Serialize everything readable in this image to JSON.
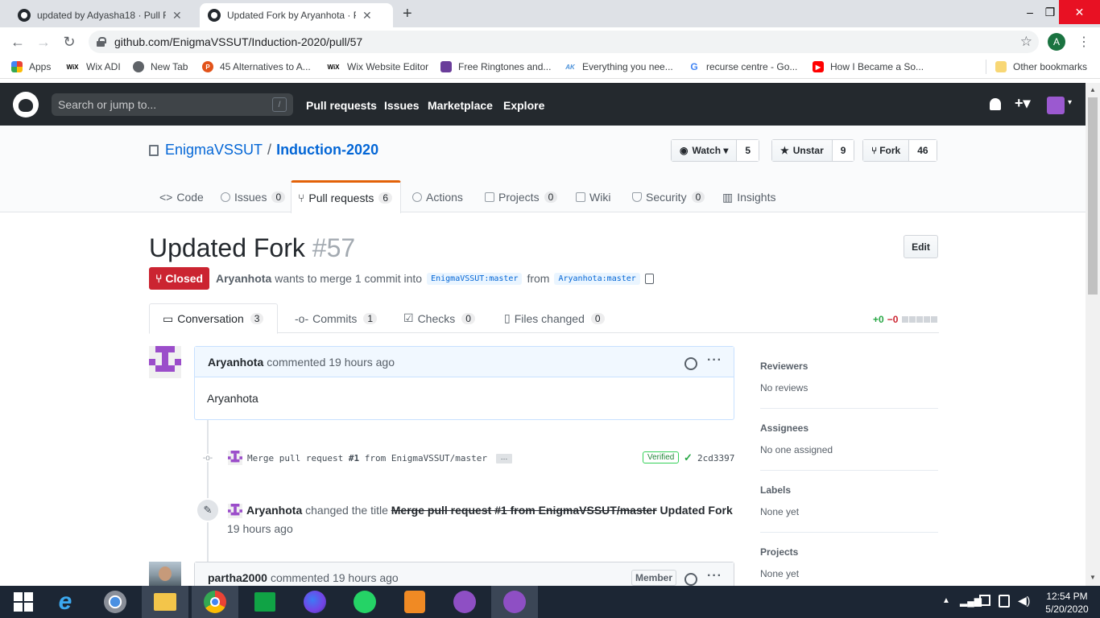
{
  "browser": {
    "tabs": [
      {
        "title": "updated by Adyasha18 · Pull Requ",
        "active": false
      },
      {
        "title": "Updated Fork by Aryanhota · Pull",
        "active": true
      }
    ],
    "new_tab": "+",
    "window_controls": {
      "minimize": "–",
      "maximize": "❐",
      "close": "✕"
    },
    "url": "github.com/EnigmaVSSUT/Induction-2020/pull/57",
    "profile_initial": "A",
    "bookmarks": [
      {
        "label": "Apps",
        "icon": "apps-grid-icon"
      },
      {
        "label": "Wix ADI",
        "icon": "wix-icon"
      },
      {
        "label": "New Tab",
        "icon": "globe-icon"
      },
      {
        "label": "45 Alternatives to A...",
        "icon": "p-badge-icon"
      },
      {
        "label": "Wix Website Editor",
        "icon": "wix-icon"
      },
      {
        "label": "Free Ringtones and...",
        "icon": "ringtone-icon"
      },
      {
        "label": "Everything you nee...",
        "icon": "ak-icon"
      },
      {
        "label": "recurse centre - Go...",
        "icon": "google-icon"
      },
      {
        "label": "How I Became a So...",
        "icon": "youtube-icon"
      }
    ],
    "other_bookmarks": "Other bookmarks"
  },
  "github_header": {
    "search_placeholder": "Search or jump to...",
    "search_key": "/",
    "nav": [
      "Pull requests",
      "Issues",
      "Marketplace",
      "Explore"
    ],
    "plus": "+▾"
  },
  "repo": {
    "owner": "EnigmaVSSUT",
    "separator": "/",
    "name": "Induction-2020",
    "watch": {
      "label": "Watch ▾",
      "count": "5"
    },
    "star": {
      "label": "Unstar",
      "count": "9"
    },
    "fork": {
      "label": "Fork",
      "count": "46"
    },
    "tabs": [
      {
        "label": "Code",
        "count": null
      },
      {
        "label": "Issues",
        "count": "0"
      },
      {
        "label": "Pull requests",
        "count": "6"
      },
      {
        "label": "Actions",
        "count": null
      },
      {
        "label": "Projects",
        "count": "0"
      },
      {
        "label": "Wiki",
        "count": null
      },
      {
        "label": "Security",
        "count": "0"
      },
      {
        "label": "Insights",
        "count": null
      }
    ]
  },
  "pr": {
    "title": "Updated Fork",
    "number": "#57",
    "edit": "Edit",
    "state": "Closed",
    "author": "Aryanhota",
    "merge_text": "wants to merge 1 commit into",
    "base_branch": "EnigmaVSSUT:master",
    "from": "from",
    "head_branch": "Aryanhota:master",
    "tabs": [
      {
        "label": "Conversation",
        "count": "3"
      },
      {
        "label": "Commits",
        "count": "1"
      },
      {
        "label": "Checks",
        "count": "0"
      },
      {
        "label": "Files changed",
        "count": "0"
      }
    ],
    "diff": {
      "add": "+0",
      "del": "−0"
    }
  },
  "timeline": {
    "comment1": {
      "author": "Aryanhota",
      "action": "commented 19 hours ago",
      "body": "Aryanhota"
    },
    "commit": {
      "message_pre": "Merge pull request ",
      "message_ref": "#1",
      "message_post": " from EnigmaVSSUT/master",
      "ellipsis": "…",
      "verified": "Verified",
      "check": "✓",
      "sha": "2cd3397"
    },
    "rename": {
      "author": "Aryanhota",
      "action": "changed the title",
      "old_title": "Merge pull request #1 from EnigmaVSSUT/master",
      "new_title": "Updated Fork",
      "time": "19 hours ago"
    },
    "comment2": {
      "author": "partha2000",
      "action": "commented 19 hours ago",
      "badge": "Member"
    }
  },
  "sidebar": [
    {
      "heading": "Reviewers",
      "value": "No reviews"
    },
    {
      "heading": "Assignees",
      "value": "No one assigned"
    },
    {
      "heading": "Labels",
      "value": "None yet"
    },
    {
      "heading": "Projects",
      "value": "None yet"
    }
  ],
  "taskbar": {
    "apps": [
      "windows-start-icon",
      "internet-explorer-icon",
      "chrome-icon",
      "file-explorer-icon",
      "chrome-icon",
      "store-icon",
      "firefox-icon",
      "whatsapp-icon",
      "sublime-icon",
      "github-desktop-icon",
      "github-desktop-icon"
    ],
    "time": "12:54 PM",
    "date": "5/20/2020"
  },
  "colors": {
    "github_header": "#24292e",
    "closed_red": "#cb2431",
    "link_blue": "#0366d6",
    "tab_accent": "#e36209",
    "taskbar": "#1c2634"
  }
}
